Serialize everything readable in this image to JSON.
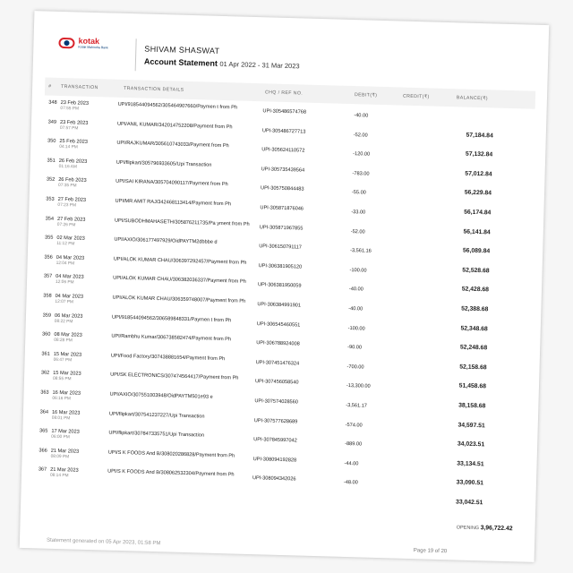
{
  "header": {
    "brand": "kotak",
    "brand_sub": "Kotak Mahindra Bank",
    "name": "SHIVAM  SHASWAT",
    "title": "Account Statement",
    "period": "01 Apr 2022 - 31 Mar 2023"
  },
  "columns": [
    "#",
    "TRANSACTION",
    "TRANSACTION DETAILS",
    "CHQ / REF NO.",
    "DEBIT(₹)",
    "CREDIT(₹)",
    "BALANCE(₹)"
  ],
  "rows": [
    {
      "num": "348",
      "date": "23 Feb 2023",
      "time": "07:55 PM",
      "details": "UPI/918544094562/305464907660/Paymen t from Ph",
      "ref": "UPI-305486574768",
      "debit": "-40.00",
      "credit": "",
      "balance": ""
    },
    {
      "num": "349",
      "date": "23 Feb 2023",
      "time": "07:57 PM",
      "details": "UPI/ANIL KUMAR/342014752208/Payment from Ph",
      "ref": "UPI-305486727713",
      "debit": "-52.00",
      "credit": "",
      "balance": "57,184.84"
    },
    {
      "num": "350",
      "date": "25 Feb 2023",
      "time": "04:14 PM",
      "details": "UPI/RAJKUMAR/305610743033/Payment from Ph",
      "ref": "UPI-305624110572",
      "debit": "-120.00",
      "credit": "",
      "balance": "57,132.84"
    },
    {
      "num": "351",
      "date": "26 Feb 2023",
      "time": "01:16 AM",
      "details": "UPI/flipkart/305796933605/Upi Transaction",
      "ref": "UPI-305735439564",
      "debit": "-783.00",
      "credit": "",
      "balance": "57,012.84"
    },
    {
      "num": "352",
      "date": "26 Feb 2023",
      "time": "07:35 PM",
      "details": "UPI/SAI KIRANA/305704090117/Payment from Ph",
      "ref": "UPI-305750844483",
      "debit": "-55.00",
      "credit": "",
      "balance": "56,229.84"
    },
    {
      "num": "353",
      "date": "27 Feb 2023",
      "time": "07:23 PM",
      "details": "UPI/MR AMIT RAJ/342468113414/Payment from Ph",
      "ref": "UPI-305871876046",
      "debit": "-33.00",
      "credit": "",
      "balance": "56,174.84"
    },
    {
      "num": "354",
      "date": "27 Feb 2023",
      "time": "07:26 PM",
      "details": "UPI/SUBODHMAHASETH/305876211735/Pa yment from Ph",
      "ref": "UPI-305871967855",
      "debit": "-52.00",
      "credit": "",
      "balance": "56,141.84"
    },
    {
      "num": "355",
      "date": "02 Mar 2023",
      "time": "11:12 PM",
      "details": "UPI/AXIO/306177497929/OidPAYTM2dbbbe d",
      "ref": "UPI-306150791117",
      "debit": "-3,561.16",
      "credit": "",
      "balance": "56,089.84"
    },
    {
      "num": "356",
      "date": "04 Mar 2023",
      "time": "12:04 PM",
      "details": "UPI/ALOK KUMAR CHAU/306397292457/Payment from Ph",
      "ref": "UPI-306381905120",
      "debit": "-100.00",
      "credit": "",
      "balance": "52,528.68"
    },
    {
      "num": "357",
      "date": "04 Mar 2023",
      "time": "12:06 PM",
      "details": "UPI/ALOK KUMAR CHAU/306382036337/Payment from Ph",
      "ref": "UPI-306381950059",
      "debit": "-40.00",
      "credit": "",
      "balance": "52,428.68"
    },
    {
      "num": "358",
      "date": "04 Mar 2023",
      "time": "12:07 PM",
      "details": "UPI/ALOK KUMAR CHAU/306359748007/Payment from Ph",
      "ref": "UPI-306384991901",
      "debit": "-40.00",
      "credit": "",
      "balance": "52,388.68"
    },
    {
      "num": "359",
      "date": "06 Mar 2023",
      "time": "08:22 PM",
      "details": "UPI/918544094562/306589848331/Paymen t from Ph",
      "ref": "UPI-306545460551",
      "debit": "-100.00",
      "credit": "",
      "balance": "52,348.68"
    },
    {
      "num": "360",
      "date": "08 Mar 2023",
      "time": "08:28 PM",
      "details": "UPI/Rambhu Kumar/306738582474/Payment from Ph",
      "ref": "UPI-306788924008",
      "debit": "-90.00",
      "credit": "",
      "balance": "52,248.68"
    },
    {
      "num": "361",
      "date": "15 Mar 2023",
      "time": "06:47 PM",
      "details": "UPI/Food Factory/307438881654/Payment from Ph",
      "ref": "UPI-307451476324",
      "debit": "-700.00",
      "credit": "",
      "balance": "52,158.68"
    },
    {
      "num": "362",
      "date": "15 Mar 2023",
      "time": "08:55 PM",
      "details": "UPI/SK ELECTRONICS/307474564417/Payment from Ph",
      "ref": "UPI-307456058540",
      "debit": "-13,300.00",
      "credit": "",
      "balance": "51,458.68"
    },
    {
      "num": "363",
      "date": "16 Mar 2023",
      "time": "06:16 PM",
      "details": "UPI/AXIO/307551003948/OidPAYTM501e93 e",
      "ref": "UPI-307574028560",
      "debit": "-3,561.17",
      "credit": "",
      "balance": "38,158.68"
    },
    {
      "num": "364",
      "date": "16 Mar 2023",
      "time": "08:01 PM",
      "details": "UPI/flipkart/307541237227/Upi Transaction",
      "ref": "UPI-307577628689",
      "debit": "-574.00",
      "credit": "",
      "balance": "34,597.51"
    },
    {
      "num": "365",
      "date": "17 Mar 2023",
      "time": "06:00 PM",
      "details": "UPI/flipkart/307847335751/Upi Transaction",
      "ref": "UPI-307845997042",
      "debit": "-889.00",
      "credit": "",
      "balance": "34,023.51"
    },
    {
      "num": "366",
      "date": "21 Mar 2023",
      "time": "08:09 PM",
      "details": "UPI/S K FOODS And B/308020286828/Payment from Ph",
      "ref": "UPI-308094192828",
      "debit": "-44.00",
      "credit": "",
      "balance": "33,134.51"
    },
    {
      "num": "367",
      "date": "21 Mar 2023",
      "time": "08:14 PM",
      "details": "UPI/S K FOODS And B/308062532304/Payment from Ph",
      "ref": "UPI-308094342026",
      "debit": "-48.00",
      "credit": "",
      "balance": "33,090.51"
    },
    {
      "num": "",
      "date": "",
      "time": "",
      "details": "",
      "ref": "",
      "debit": "",
      "credit": "",
      "balance": "33,042.51"
    }
  ],
  "opening": {
    "label": "OPENING",
    "value": "3,96,722.42"
  },
  "footer": {
    "generated": "Statement generated on 05 Apr 2023, 01:58 PM",
    "page": "Page 19 of  20"
  },
  "colors": {
    "brand_red": "#d8232a",
    "brand_blue": "#003874"
  }
}
